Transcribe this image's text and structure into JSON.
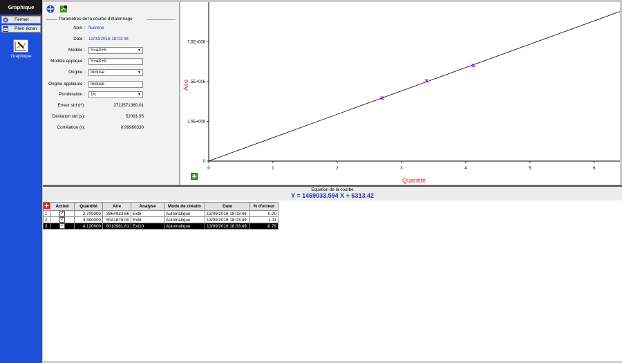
{
  "sidebar": {
    "title": "Graphique",
    "close_label": "Fermer",
    "fullscreen_label": "Plein écran",
    "graph_label": "Graphique"
  },
  "params": {
    "group_title": "Paramètres de la courbe d'étalonnage",
    "name_label": "Nom :",
    "name_value": "fluorene",
    "date_label": "Date :",
    "date_value": "13/09/2016 18:03:48",
    "model_label": "Modèle :",
    "model_value": "Y=aX+b",
    "applied_model_label": "Modèle appliqué :",
    "applied_model_value": "Y=aX+b",
    "origin_label": "Origine :",
    "origin_value": "Incluse",
    "applied_origin_label": "Origine appliquée :",
    "applied_origin_value": "Incluse",
    "weighting_label": "Pondération :",
    "weighting_value": "1/c",
    "std_error_label": "Erreur std (r²):",
    "std_error_value": "2713571360.01",
    "std_dev_label": "Déviation std (s):",
    "std_dev_value": "52091.95",
    "correlation_label": "Corrélation (r):",
    "correlation_value": "0.99960330"
  },
  "chart_data": {
    "type": "scatter",
    "xlabel": "Quantité",
    "ylabel": "Aire",
    "xlim": [
      0,
      6.4
    ],
    "ylim": [
      0,
      10000000
    ],
    "x_ticks": [
      "0",
      "1",
      "2",
      "3",
      "4",
      "5",
      "6"
    ],
    "y_ticks": [
      {
        "value": 0,
        "label": "0"
      },
      {
        "value": 2500000,
        "label": "2.5E+006"
      },
      {
        "value": 5000000,
        "label": "5E+006"
      },
      {
        "value": 7500000,
        "label": "7.5E+006"
      }
    ],
    "fit_line": {
      "slope": 1469033.594,
      "intercept": 6313.42
    },
    "points": [
      {
        "x": 2.7,
        "y": 3964933.66
      },
      {
        "x": 3.39,
        "y": 5041878.0
      },
      {
        "x": 4.12,
        "y": 6010961.61
      }
    ],
    "line_color": "#000000",
    "point_color": "#8a1ad0",
    "axis_label_color": "#e8241c"
  },
  "equation": {
    "title": "Equation de la courbe",
    "text": "Y = 1469033.594 X + 6313.42"
  },
  "table": {
    "headers": [
      "Activé",
      "Quantité",
      "Aire",
      "Analyse",
      "Mode de créatio",
      "Date",
      "% d'erreur"
    ],
    "rows": [
      {
        "num": "1",
        "qty": "2.700000",
        "area": "3964933.66",
        "analysis": "Ext6",
        "mode": "Automatique",
        "date": "13/09/2016 18:03:46",
        "err": "-0.20"
      },
      {
        "num": "2",
        "qty": "3.390000",
        "area": "5041878.00",
        "analysis": "Ext8",
        "mode": "Automatique",
        "date": "13/09/2016 18:03:49",
        "err": "1.11"
      },
      {
        "num": "3",
        "qty": "4.120000",
        "area": "6010961.61",
        "analysis": "Ext10",
        "mode": "Automatique",
        "date": "13/09/2016 18:03:49",
        "err": "-0.79"
      }
    ]
  }
}
